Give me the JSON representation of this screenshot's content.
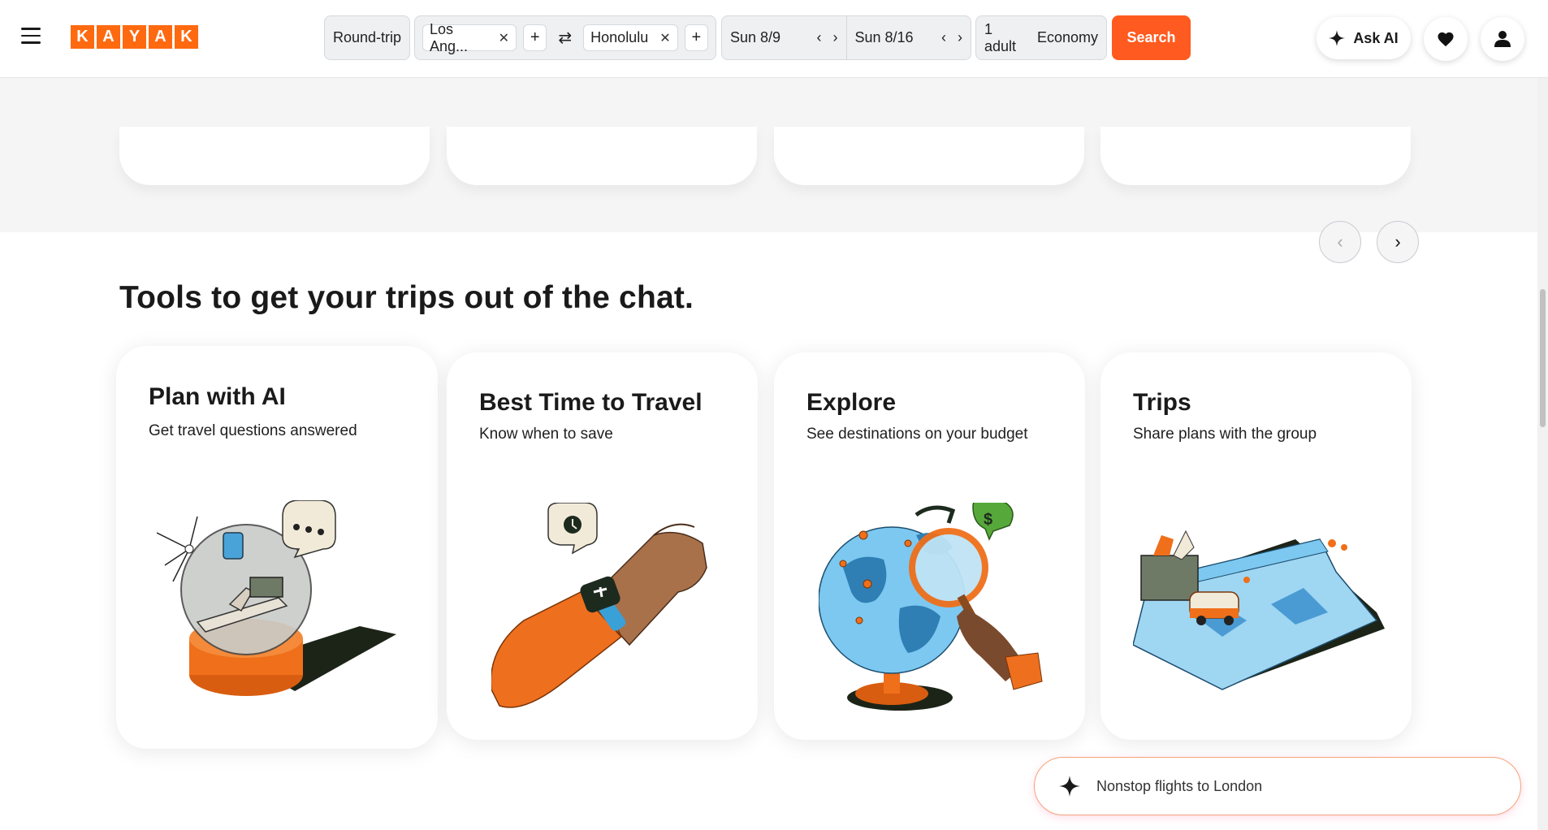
{
  "header": {
    "logo_letters": [
      "K",
      "A",
      "Y",
      "A",
      "K"
    ],
    "trip_type": "Round-trip",
    "origin": "Los Ang...",
    "destination": "Honolulu",
    "depart_date": "Sun 8/9",
    "return_date": "Sun 8/16",
    "travelers": "1 adult",
    "cabin": "Economy",
    "search_label": "Search",
    "ask_ai_label": "Ask AI",
    "icons": [
      "menu-icon",
      "close-icon",
      "plus-icon",
      "swap-icon",
      "chevron-left-icon",
      "chevron-right-icon",
      "sparkle-icon",
      "heart-icon",
      "user-icon"
    ]
  },
  "tools": {
    "title": "Tools to get your trips out of the chat.",
    "cards": [
      {
        "title": "Plan with AI",
        "subtitle": "Get travel questions answered",
        "illustration": "snow-globe-illustration"
      },
      {
        "title": "Best Time to Travel",
        "subtitle": "Know when to save",
        "illustration": "smartwatch-illustration"
      },
      {
        "title": "Explore",
        "subtitle": "See destinations on your budget",
        "illustration": "globe-magnifier-illustration"
      },
      {
        "title": "Trips",
        "subtitle": "Share plans with the group",
        "illustration": "map-van-illustration"
      }
    ]
  },
  "chat": {
    "prompt": "Nonstop flights to London"
  },
  "colors": {
    "brand_orange": "#ff690f",
    "search_button": "#ff5a1f",
    "globe_blue": "#7cc8f0",
    "accent_green": "#57a83a"
  }
}
